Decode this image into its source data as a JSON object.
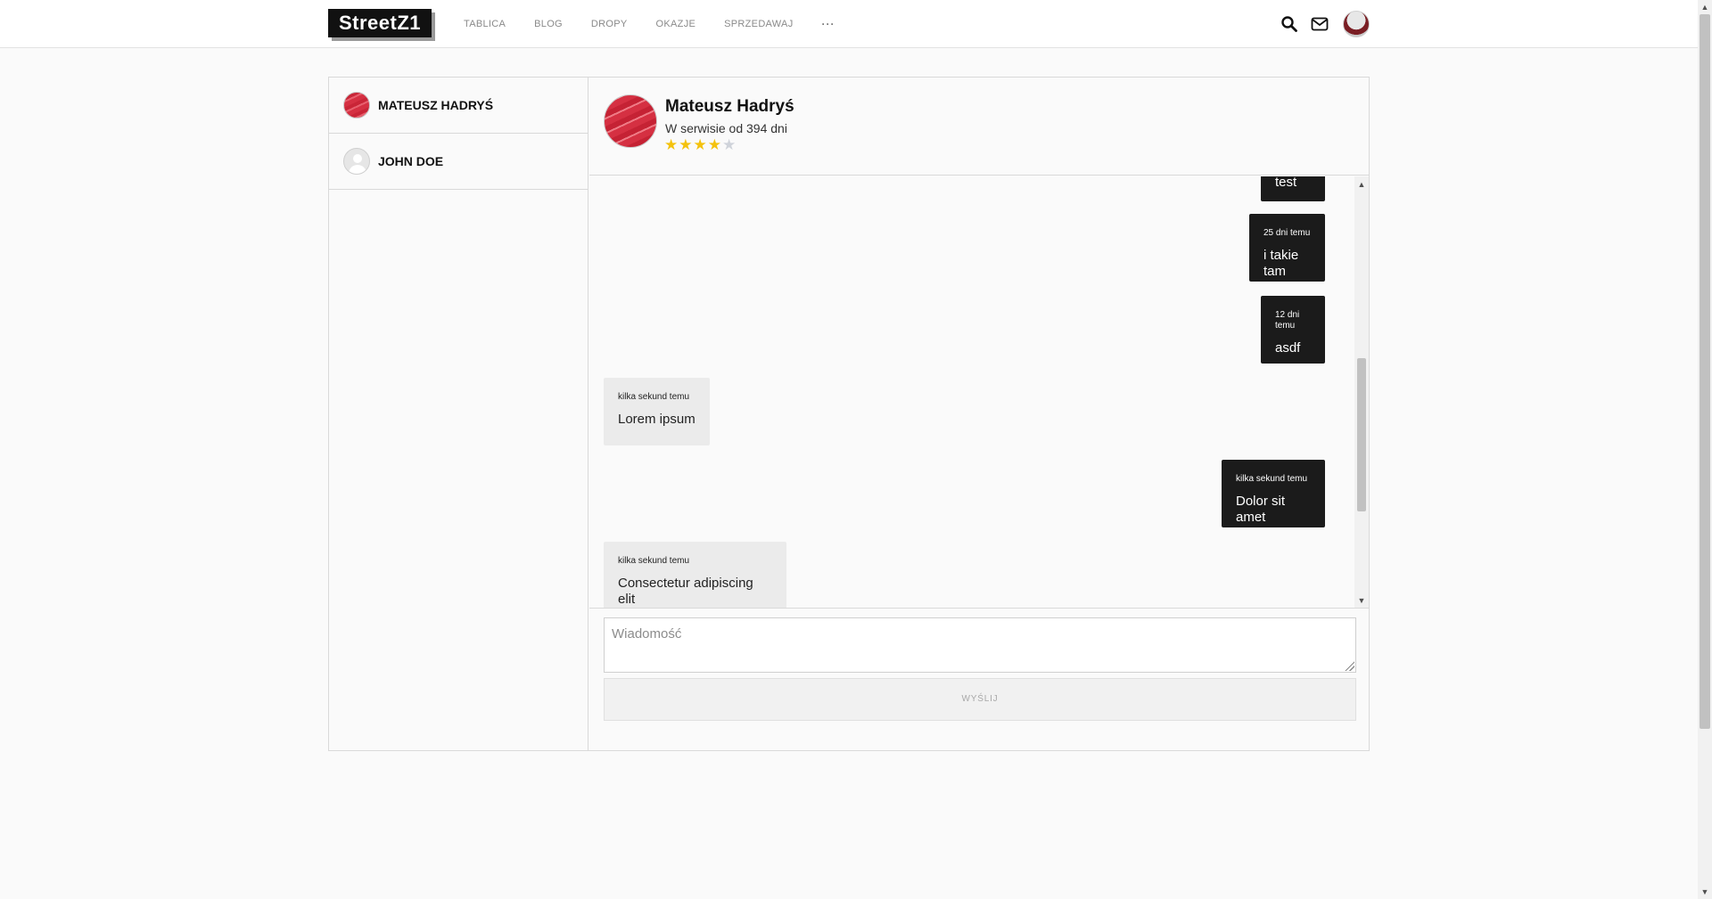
{
  "brand": {
    "logo": "StreetZ1"
  },
  "nav": {
    "items": [
      "TABLICA",
      "BLOG",
      "DROPY",
      "OKAZJE",
      "SPRZEDAWAJ"
    ],
    "more": "···"
  },
  "icons": {
    "search": "search-icon",
    "mail": "mail-icon",
    "avatar": "user-avatar"
  },
  "conversations": [
    {
      "name": "MATEUSZ HADRYŚ",
      "avatar": "red-pattern"
    },
    {
      "name": "JOHN DOE",
      "avatar": "default-user"
    }
  ],
  "chat_header": {
    "name": "Mateusz Hadryś",
    "since": "W serwisie od 394 dni",
    "rating": 4,
    "rating_max": 5
  },
  "messages": [
    {
      "direction": "out",
      "time": "",
      "text": "test"
    },
    {
      "direction": "out",
      "time": "25 dni temu",
      "text": "i takie tam"
    },
    {
      "direction": "out",
      "time": "12 dni temu",
      "text": "asdf"
    },
    {
      "direction": "in",
      "time": "kilka sekund temu",
      "text": "Lorem ipsum"
    },
    {
      "direction": "out",
      "time": "kilka sekund temu",
      "text": "Dolor sit amet"
    },
    {
      "direction": "in",
      "time": "kilka sekund temu",
      "text": "Consectetur adipiscing elit"
    }
  ],
  "compose": {
    "placeholder": "Wiadomość",
    "value": "",
    "send_label": "WYŚLIJ"
  },
  "colors": {
    "outgoing_bubble": "#1b1b1b",
    "incoming_bubble": "#ebebeb",
    "star": "#f4c20d",
    "star_empty": "#cfd3da"
  }
}
